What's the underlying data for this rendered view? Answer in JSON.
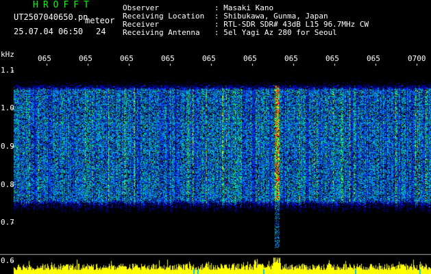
{
  "header": {
    "title": "HROFFT",
    "filename": "UT2507040650.pn",
    "mode": "meteor",
    "datetime": "25.07.04 06:50",
    "count": "24",
    "info_labels": [
      "Observer",
      "Receiving Location",
      "Receiver",
      "Receiving Antenna"
    ],
    "info_values": [
      ": Masaki Kano",
      ": Shibukawa, Gunma, Japan",
      ": RTL-SDR SDR# 43dB L15 96.7MHz CW",
      ": 5el Yagi Az 280 for Seoul"
    ]
  },
  "chart_data": {
    "type": "heatmap",
    "ylabel": "kHz",
    "y_ticks": [
      "1.1",
      "1.0",
      "0.9",
      "0.8",
      "0.7",
      "0.6"
    ],
    "x_ticks": [
      "065",
      "065",
      "065",
      "065",
      "065",
      "065",
      "065",
      "065",
      "065",
      "0700"
    ],
    "ylim": [
      0.6,
      1.15
    ],
    "signal_band_khz": [
      0.76,
      1.05
    ],
    "strong_echo_minute_approx": 6.3,
    "colors": {
      "background": "#000000",
      "noise_low": "#0000cc",
      "noise_mid": "#00c0c0",
      "noise_high": "#ffff00",
      "echo": "#ff0000",
      "power_trace": "#ffff00"
    }
  }
}
